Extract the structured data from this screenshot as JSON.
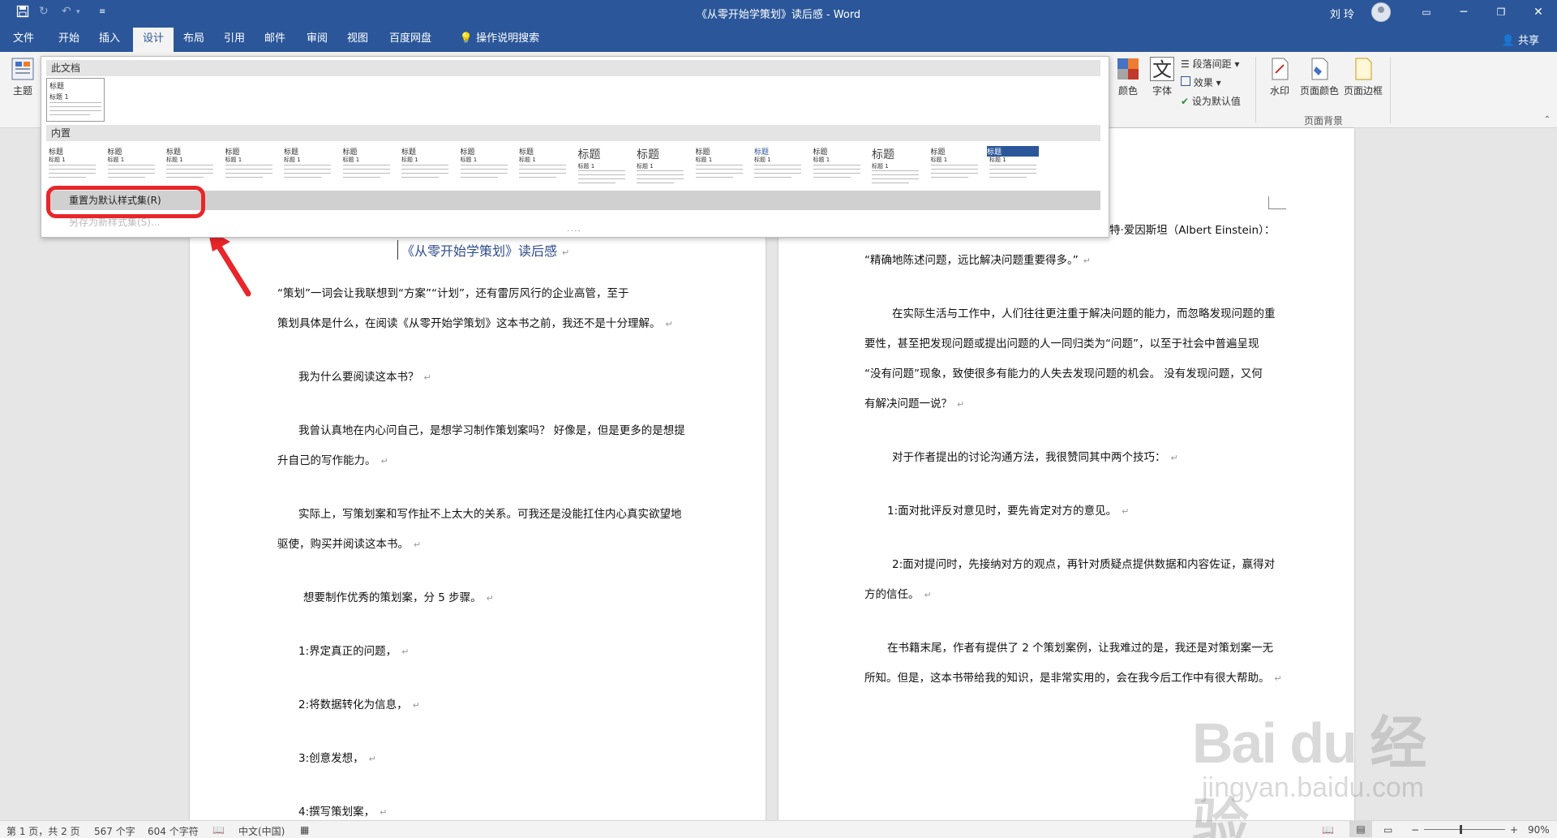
{
  "window": {
    "title": "《从零开始学策划》读后感 - Word",
    "user": "刘 玲",
    "controls": [
      "ribbon-display-options",
      "minimize",
      "restore",
      "close"
    ]
  },
  "tabs": [
    {
      "label": "文件",
      "active": false
    },
    {
      "label": "开始",
      "active": false
    },
    {
      "label": "插入",
      "active": false
    },
    {
      "label": "设计",
      "active": true
    },
    {
      "label": "布局",
      "active": false
    },
    {
      "label": "引用",
      "active": false
    },
    {
      "label": "邮件",
      "active": false
    },
    {
      "label": "审阅",
      "active": false
    },
    {
      "label": "视图",
      "active": false
    },
    {
      "label": "百度网盘",
      "active": false
    }
  ],
  "tell_me": "操作说明搜索",
  "share": "共享",
  "ribbon": {
    "theme_label": "主题",
    "colors_label": "颜色",
    "fonts_label": "字体",
    "font_glyph": "文",
    "paragraph_spacing": "段落间距",
    "effects": "效果",
    "set_default": "设为默认值",
    "watermark": "水印",
    "page_color": "页面颜色",
    "page_borders": "页面边框",
    "page_background_group": "页面背景"
  },
  "gallery": {
    "this_document": "此文档",
    "builtin": "内置",
    "thumb_title": "标题",
    "thumb_sub": "标题 1",
    "reset_label": "重置为默认样式集(R)",
    "save_label": "另存为新样式集(S)...",
    "builtin_titles": [
      "标题",
      "标题",
      "标题",
      "标题",
      "标题",
      "标题",
      "标题",
      "标题",
      "标题",
      "标题",
      "标题",
      "标题",
      "标题",
      "标题",
      "标题",
      "标题",
      "标题"
    ]
  },
  "document": {
    "title": "《从零开始学策划》读后感",
    "left_paragraphs": [
      "“策划”一词会让我联想到“方案”“计划”，还有雷厉风行的企业高管，至于",
      "策划具体是什么，在阅读《从零开始学策划》这本书之前，我还不是十分理解。",
      "我为什么要阅读这本书？",
      "我曾认真地在内心问自己，是想学习制作策划案吗？ 好像是，但是更多的是想提",
      "升自己的写作能力。",
      "实际上，写策划案和写作扯不上太大的关系。可我还是没能扛住内心真实欲望地",
      "驱使，购买并阅读这本书。",
      "想要制作优秀的策划案，分 5 步骤。",
      "1:界定真正的问题，",
      "2:将数据转化为信息，",
      "3:创意发想，",
      "4:撰写策划案，"
    ],
    "right_paragraphs": [
      "特·爱因斯坦（Albert Einstein）：",
      "“精确地陈述问题，远比解决问题重要得多。”",
      "在实际生活与工作中，人们往往更注重于解决问题的能力，而忽略发现问题的重",
      "要性，甚至把发现问题或提出问题的人一同归类为“问题”，以至于社会中普遍呈现",
      "“没有问题”现象，致使很多有能力的人失去发现问题的机会。 没有发现问题，又何",
      "有解决问题一说？",
      "对于作者提出的讨论沟通方法，我很赞同其中两个技巧：",
      "1:面对批评反对意见时，要先肯定对方的意见。",
      "2:面对提问时，先接纳对方的观点，再针对质疑点提供数据和内容佐证，赢得对",
      "方的信任。",
      "在书籍末尾，作者有提供了 2 个策划案例，让我难过的是，我还是对策划案一无",
      "所知。但是，这本书带给我的知识，是非常实用的，会在我今后工作中有很大帮助。"
    ]
  },
  "status": {
    "page": "第 1 页，共 2 页",
    "words": "567 个字",
    "chars": "604 个字符",
    "language": "中文(中国)",
    "zoom": "90%"
  },
  "watermark": {
    "brand": "Bai du 经验",
    "url": "jingyan.baidu.com"
  },
  "colors": {
    "title_bar": "#2b579a",
    "ribbon": "#f3f3f3",
    "highlight": "#e8262a",
    "doc_title": "#2e4c8a"
  }
}
